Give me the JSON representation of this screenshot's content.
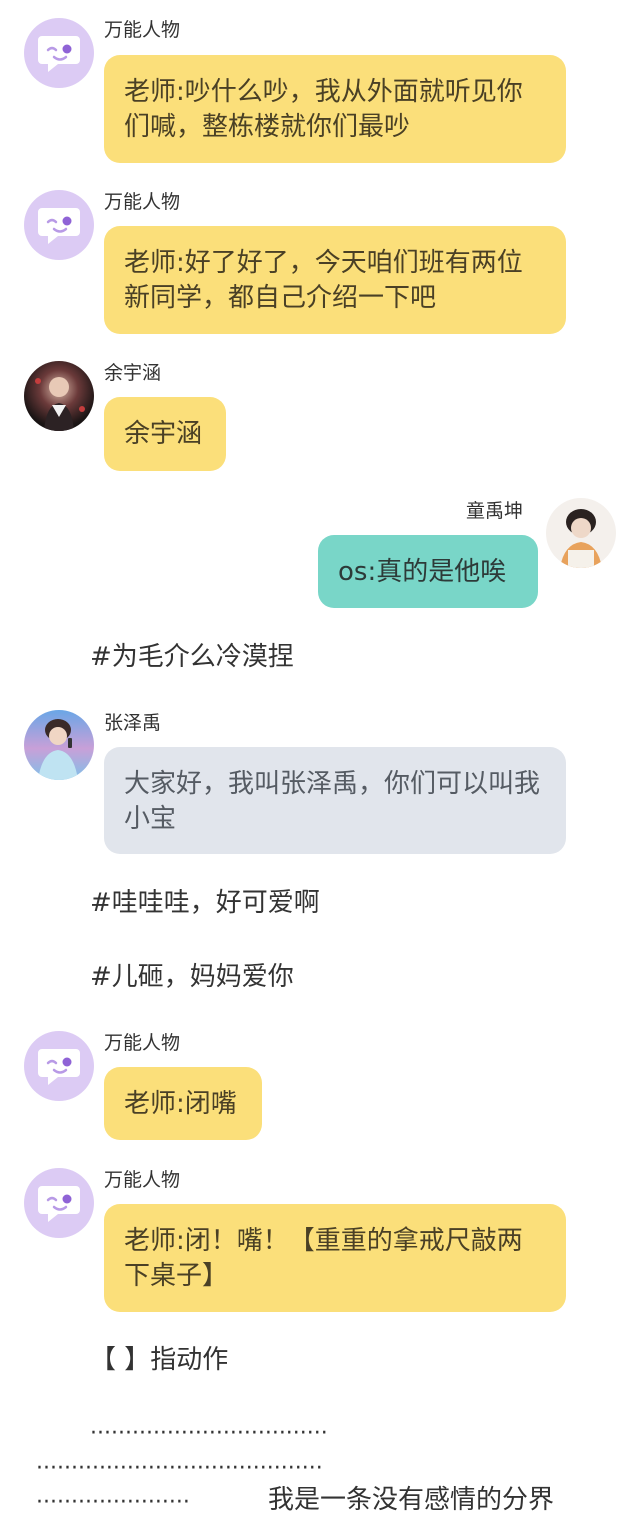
{
  "messages": [
    {
      "name": "万能人物",
      "text": "老师:吵什么吵，我从外面就听见你们喊，整栋楼就你们最吵"
    },
    {
      "name": "万能人物",
      "text": "老师:好了好了，今天咱们班有两位新同学，都自己介绍一下吧"
    },
    {
      "name": "余宇涵",
      "text": "余宇涵"
    },
    {
      "name": "童禹坤",
      "text": "os:真的是他唉"
    },
    {
      "name": "张泽禹",
      "text": "大家好，我叫张泽禹，你们可以叫我小宝"
    },
    {
      "name": "万能人物",
      "text": "老师:闭嘴"
    },
    {
      "name": "万能人物",
      "text": "老师:闭！嘴！【重重的拿戒尺敲两下桌子】"
    }
  ],
  "notes": {
    "n1": "#为毛介么冷漠捏",
    "n2": "#哇哇哇，好可爱啊",
    "n3": "#儿砸，妈妈爱你",
    "n4": "【 】指动作"
  },
  "divider": {
    "dots1": "··································",
    "dots2": "·········································",
    "dots3": "······················",
    "text": "我是一条没有感情的分界"
  },
  "colors": {
    "yellow_bubble": "#fbdf7a",
    "teal_bubble": "#79d6c8",
    "gray_bubble": "#e1e5ec",
    "avatar_purple": "#dccbf4"
  },
  "icons": {
    "generic_avatar": "chat-bubble-wink-icon"
  }
}
